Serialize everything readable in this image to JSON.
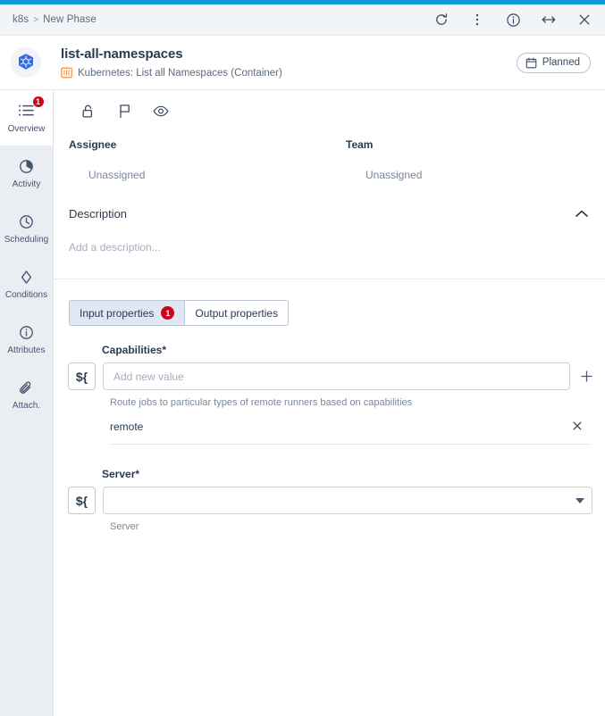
{
  "window": {
    "accent_color": "#0d9adb",
    "breadcrumb": {
      "root": "k8s",
      "separator": ">",
      "current": "New Phase"
    },
    "actions": [
      {
        "name": "refresh-button",
        "label": "Refresh"
      },
      {
        "name": "more-menu-button",
        "label": "More options"
      },
      {
        "name": "info-button",
        "label": "Info"
      },
      {
        "name": "resize-button",
        "label": "Resize"
      },
      {
        "name": "close-button",
        "label": "Close"
      }
    ]
  },
  "header": {
    "logo_icon": "kubernetes-icon",
    "title": "list-all-namespaces",
    "subtitle_icon": "container-icon",
    "subtitle": "Kubernetes: List all Namespaces (Container)",
    "status": {
      "icon": "calendar-icon",
      "label": "Planned"
    },
    "subtitle_icon_color": "#f5a05a"
  },
  "sidebar": {
    "items": [
      {
        "label": "Overview",
        "icon": "list-icon",
        "active": true,
        "badge": "1"
      },
      {
        "label": "Activity",
        "icon": "pie-clock-icon",
        "active": false,
        "badge": ""
      },
      {
        "label": "Scheduling",
        "icon": "clock-icon",
        "active": false,
        "badge": ""
      },
      {
        "label": "Conditions",
        "icon": "diamond-icon",
        "active": false,
        "badge": ""
      },
      {
        "label": "Attributes",
        "icon": "info-icon",
        "active": false,
        "badge": ""
      },
      {
        "label": "Attach.",
        "icon": "paperclip-icon",
        "active": false,
        "badge": ""
      }
    ],
    "badge_color": "#d0021b"
  },
  "toolbar": {
    "icons": [
      {
        "name": "unlock-icon",
        "label": "Lock"
      },
      {
        "name": "flag-icon",
        "label": "Flag"
      },
      {
        "name": "eye-icon",
        "label": "Watch"
      }
    ]
  },
  "meta": {
    "assignee_label": "Assignee",
    "assignee_value": "Unassigned",
    "team_label": "Team",
    "team_value": "Unassigned"
  },
  "description": {
    "section_title": "Description",
    "collapse_icon": "chevron-up-icon",
    "placeholder": "Add a description..."
  },
  "tabs": [
    {
      "label": "Input properties",
      "active": true,
      "badge": "1"
    },
    {
      "label": "Output properties",
      "active": false,
      "badge": ""
    }
  ],
  "fields": {
    "capabilities": {
      "label": "Capabilities",
      "required_marker": "*",
      "expression_button": "${",
      "placeholder": "Add new value",
      "value": "",
      "add_icon": "plus-icon",
      "help": "Route jobs to particular types of remote runners based on capabilities",
      "values": [
        {
          "text": "remote",
          "remove_icon": "close-icon"
        }
      ]
    },
    "server": {
      "label": "Server",
      "required_marker": "*",
      "expression_button": "${",
      "value": "",
      "caret_icon": "chevron-down-icon",
      "help": "Server"
    }
  }
}
